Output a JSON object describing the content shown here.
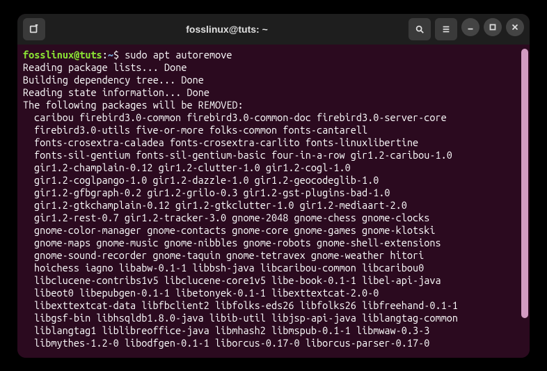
{
  "titlebar": {
    "title": "fosslinux@tuts: ~"
  },
  "prompt": {
    "user_host": "fosslinux@tuts",
    "colon": ":",
    "path": "~",
    "dollar": "$",
    "command": "sudo apt autoremove"
  },
  "output": {
    "lines": [
      "Reading package lists... Done",
      "Building dependency tree... Done",
      "Reading state information... Done",
      "The following packages will be REMOVED:"
    ],
    "packages": [
      "caribou firebird3.0-common firebird3.0-common-doc firebird3.0-server-core",
      "firebird3.0-utils five-or-more folks-common fonts-cantarell",
      "fonts-crosextra-caladea fonts-crosextra-carlito fonts-linuxlibertine",
      "fonts-sil-gentium fonts-sil-gentium-basic four-in-a-row gir1.2-caribou-1.0",
      "gir1.2-champlain-0.12 gir1.2-clutter-1.0 gir1.2-cogl-1.0",
      "gir1.2-coglpango-1.0 gir1.2-dazzle-1.0 gir1.2-geocodeglib-1.0",
      "gir1.2-gfbgraph-0.2 gir1.2-grilo-0.3 gir1.2-gst-plugins-bad-1.0",
      "gir1.2-gtkchamplain-0.12 gir1.2-gtkclutter-1.0 gir1.2-mediaart-2.0",
      "gir1.2-rest-0.7 gir1.2-tracker-3.0 gnome-2048 gnome-chess gnome-clocks",
      "gnome-color-manager gnome-contacts gnome-core gnome-games gnome-klotski",
      "gnome-maps gnome-music gnome-nibbles gnome-robots gnome-shell-extensions",
      "gnome-sound-recorder gnome-taquin gnome-tetravex gnome-weather hitori",
      "hoichess iagno libabw-0.1-1 libbsh-java libcaribou-common libcaribou0",
      "libclucene-contribs1v5 libclucene-core1v5 libe-book-0.1-1 libel-api-java",
      "libeot0 libepubgen-0.1-1 libetonyek-0.1-1 libexttextcat-2.0-0",
      "libexttextcat-data libfbclient2 libfolks-eds26 libfolks26 libfreehand-0.1-1",
      "libgsf-bin libhsqldb1.8.0-java libib-util libjsp-api-java liblangtag-common",
      "liblangtag1 liblibreoffice-java libmhash2 libmspub-0.1-1 libmwaw-0.3-3",
      "libmythes-1.2-0 libodfgen-0.1-1 liborcus-0.17-0 liborcus-parser-0.17-0"
    ]
  }
}
